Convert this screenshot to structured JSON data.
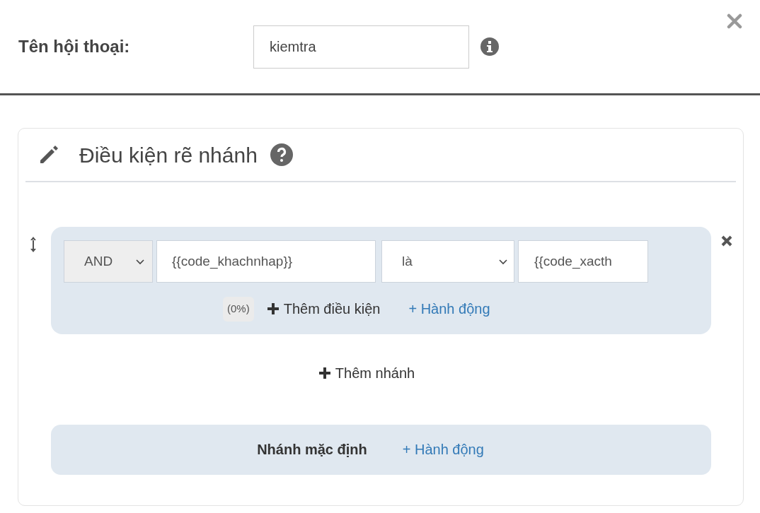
{
  "dialog": {
    "name_label": "Tên hội thoại:",
    "name_value": "kiemtra"
  },
  "section": {
    "title": "Điều kiện rẽ nhánh"
  },
  "branches": [
    {
      "conditions": [
        {
          "join": "AND",
          "field": "{{code_khachnhap}}",
          "operator": "là",
          "value": "{{code_xacth"
        }
      ],
      "percent": "(0%)",
      "add_condition": "Thêm điều kiện",
      "action": "+ Hành động"
    }
  ],
  "add_branch": "Thêm nhánh",
  "default_branch": {
    "label": "Nhánh mặc định",
    "action": "+ Hành động"
  }
}
